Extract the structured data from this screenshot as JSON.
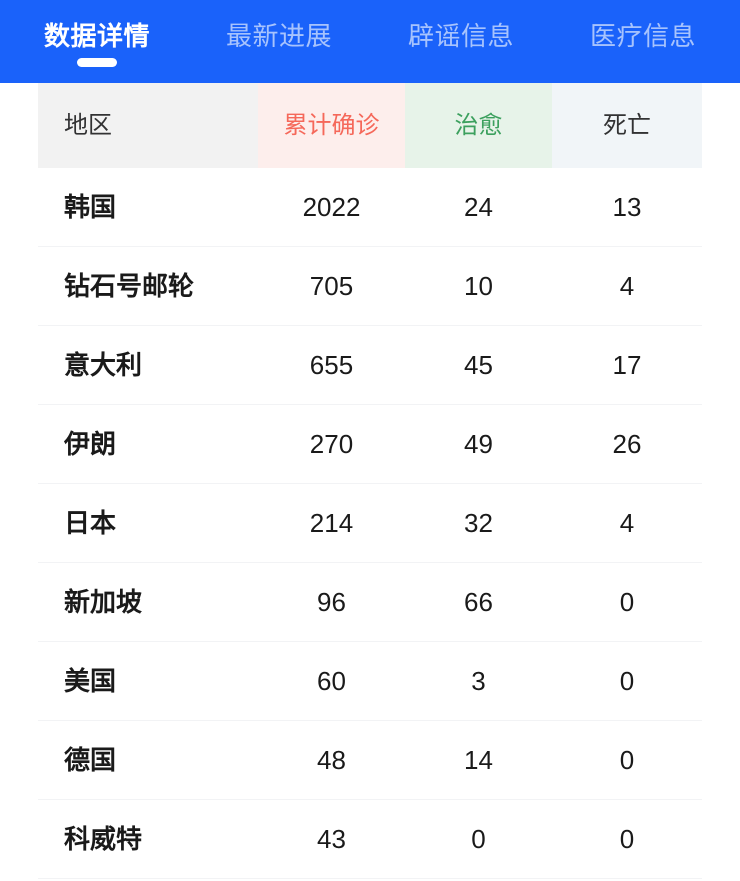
{
  "tabs": [
    {
      "label": "数据详情",
      "active": true
    },
    {
      "label": "最新进展",
      "active": false
    },
    {
      "label": "辟谣信息",
      "active": false
    },
    {
      "label": "医疗信息",
      "active": false
    }
  ],
  "table": {
    "headers": {
      "region": "地区",
      "confirmed": "累计确诊",
      "cured": "治愈",
      "dead": "死亡"
    },
    "header_colors": {
      "region_bg": "#f2f2f2",
      "region_text": "#323233",
      "confirmed_bg": "#fdeeec",
      "confirmed_text": "#f5685a",
      "cured_bg": "#e7f3e9",
      "cured_text": "#3ca05e",
      "dead_bg": "#f1f5f8",
      "dead_text": "#323233"
    },
    "rows": [
      {
        "region": "韩国",
        "confirmed": "2022",
        "cured": "24",
        "dead": "13"
      },
      {
        "region": "钻石号邮轮",
        "confirmed": "705",
        "cured": "10",
        "dead": "4"
      },
      {
        "region": "意大利",
        "confirmed": "655",
        "cured": "45",
        "dead": "17"
      },
      {
        "region": "伊朗",
        "confirmed": "270",
        "cured": "49",
        "dead": "26"
      },
      {
        "region": "日本",
        "confirmed": "214",
        "cured": "32",
        "dead": "4"
      },
      {
        "region": "新加坡",
        "confirmed": "96",
        "cured": "66",
        "dead": "0"
      },
      {
        "region": "美国",
        "confirmed": "60",
        "cured": "3",
        "dead": "0"
      },
      {
        "region": "德国",
        "confirmed": "48",
        "cured": "14",
        "dead": "0"
      },
      {
        "region": "科威特",
        "confirmed": "43",
        "cured": "0",
        "dead": "0"
      }
    ]
  },
  "theme": {
    "tabbar_bg": "#1a62fa",
    "tab_active_text": "#ffffff",
    "tab_inactive_text": "rgba(255,255,255,0.62)",
    "row_divider": "#f2f3f5"
  }
}
